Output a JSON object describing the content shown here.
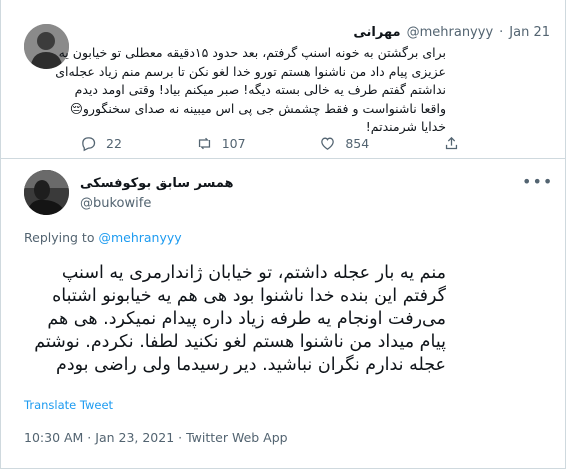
{
  "tweet1": {
    "name": "مهرانی",
    "handle": "@mehranyyy",
    "separator": "·",
    "date": "Jan 21",
    "text": "برای برگشتن به خونه اسنپ گرفتم، بعد حدود ۱۵دقیقه معطلی تو خیابون یه عزیزی پیام داد من ناشنوا هستم تورو خدا لغو نکن تا برسم منم زیاد عجله‌ای نداشتم گفتم طرف یه خالی بسته دیگه! صبر میکنم بیاد! وقتی اومد دیدم واقعا ناشنواست و فقط چشمش جی پی اس میبینه نه صدای سخنگورو😔خدایا شرمندتم!",
    "replies": "22",
    "retweets": "107",
    "likes": "854"
  },
  "tweet2": {
    "name": "همسر سابق بوکوفسکی",
    "handle": "@bukowife",
    "replying_prefix": "Replying to",
    "replying_to": "@mehranyyy",
    "text": "منم یه بار عجله داشتم، تو خیابان ژاندارمری یه اسنپ گرفتم این بنده خدا ناشنوا بود هی هم یه خیابونو اشتباه می‌رفت اونجام یه طرفه زیاد داره پیدام نمیکرد. هی هم پیام میداد من ناشنوا هستم لغو نکنید لطفا. نکردم. نوشتم عجله ندارم نگران نباشید. دیر رسیدما ولی راضی بودم",
    "translate_label": "Translate Tweet",
    "timestamp": "10:30 AM · Jan 23, 2021 · Twitter Web App"
  },
  "icons": {
    "reply": "reply-icon",
    "retweet": "retweet-icon",
    "like": "like-icon",
    "share": "share-icon",
    "more": "more-icon"
  },
  "colors": {
    "text": "#0f1419",
    "muted": "#536471",
    "link": "#1d9bf0",
    "border": "#cfd9de"
  }
}
